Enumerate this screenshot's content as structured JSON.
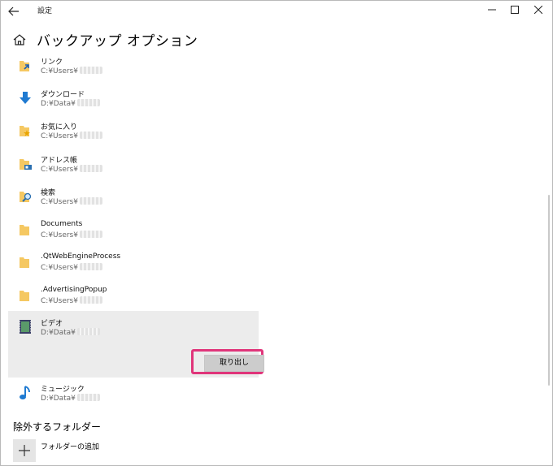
{
  "window": {
    "title": "設定"
  },
  "page": {
    "title": "バックアップ オプション"
  },
  "folders": [
    {
      "name": "リンク",
      "path": "C:¥Users¥",
      "icon": "links-folder-icon"
    },
    {
      "name": "ダウンロード",
      "path": "D:¥Data¥",
      "icon": "download-arrow-icon"
    },
    {
      "name": "お気に入り",
      "path": "C:¥Users¥",
      "icon": "favorites-folder-icon"
    },
    {
      "name": "アドレス帳",
      "path": "C:¥Users¥",
      "icon": "contacts-folder-icon"
    },
    {
      "name": "検索",
      "path": "C:¥Users¥",
      "icon": "searches-folder-icon"
    },
    {
      "name": "Documents",
      "path": "C:¥Users¥",
      "icon": "folder-icon"
    },
    {
      "name": ".QtWebEngineProcess",
      "path": "C:¥Users¥",
      "icon": "folder-icon"
    },
    {
      "name": ".AdvertisingPopup",
      "path": "C:¥Users¥",
      "icon": "folder-icon"
    },
    {
      "name": "ビデオ",
      "path": "D:¥Data¥",
      "icon": "videos-folder-icon"
    },
    {
      "name": "ミュージック",
      "path": "D:¥Data¥",
      "icon": "music-note-icon"
    }
  ],
  "selected": {
    "eject_label": "取り出し"
  },
  "excluded": {
    "title": "除外するフォルダー",
    "add_label": "フォルダーの追加"
  },
  "colors": {
    "highlight": "#e0357a",
    "folder": "#f5c862",
    "arrow": "#1f7ad1"
  }
}
